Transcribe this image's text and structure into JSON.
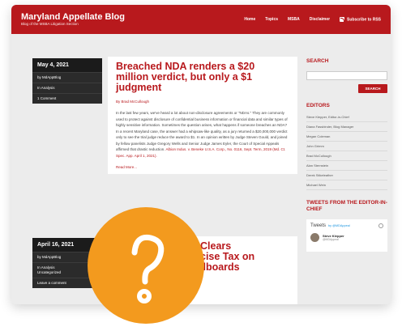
{
  "site": {
    "title": "Maryland Appellate Blog",
    "subtitle": "Blog of the MSBA Litigation Section",
    "nav": [
      "Home",
      "Topics",
      "MSBA",
      "Disclaimer"
    ],
    "rss_label": "Subscribe to RSS"
  },
  "post1": {
    "date": "May 4, 2021",
    "by": "by MdAppBlog",
    "category": "In Analysis",
    "comments": "1 Comment",
    "title": "Breached NDA renders a $20 million verdict, but only a $1 judgment",
    "byline": "By Brad McCullough",
    "body": "In the last few years, we've heard a lot about non-disclosure agreements or \"NDAs.\" They are commonly used to protect against disclosure of confidential business information or financial data and similar types of highly sensitive information. Sometimes the question arises, what happens if someone breaches an NDA? In a recent Maryland case, the answer had a whipsaw-like quality, as a jury returned a $20,000,000 verdict only to see the trial judge reduce the award to $1. In an opinion written by Judge Steven Gould, and joined by fellow panelists Judge Gregory Wells and Senior Judge James Eyler, the Court of Special Appeals affirmed that drastic reduction.",
    "citation": "Albion Indus. v. Beneke U.S.A. Corp., No. 0116, Sept. Term, 2019 (Md. Ct. Spec. App. April 1, 2021).",
    "read_more": "Read More..."
  },
  "post2": {
    "date": "April 16, 2021",
    "by": "by MdAppBlog",
    "category": "In Analysis",
    "category2": "Uncategorized",
    "comments": "Leave a comment",
    "title_line1": "Clears",
    "title_line2": "cise Tax on",
    "title_line3": "llboards"
  },
  "sidebar": {
    "search_heading": "SEARCH",
    "search_button": "SEARCH",
    "editors_heading": "EDITORS",
    "editors": [
      "Steve Klepper, Editor-in-Chief",
      "Diana Fassbinder, Blog Manager",
      "Megan Coleman",
      "John Grimm",
      "Brad McCullough",
      "Alan Sternstein",
      "Derek Stikeleather",
      "Michael Wein"
    ],
    "tweets_heading": "TWEETS FROM THE EDITOR-IN-CHIEF",
    "tweets_label": "Tweets",
    "tweets_handle": "by @MDAppeal",
    "tweet_author": "Steve Klepper",
    "tweet_author_handle": "@MDAppeal"
  },
  "colors": {
    "brand": "#b8191d",
    "badge": "#f39a1e"
  },
  "icons": {
    "badge_icon": "question-mark-icon",
    "rss": "rss-icon"
  }
}
